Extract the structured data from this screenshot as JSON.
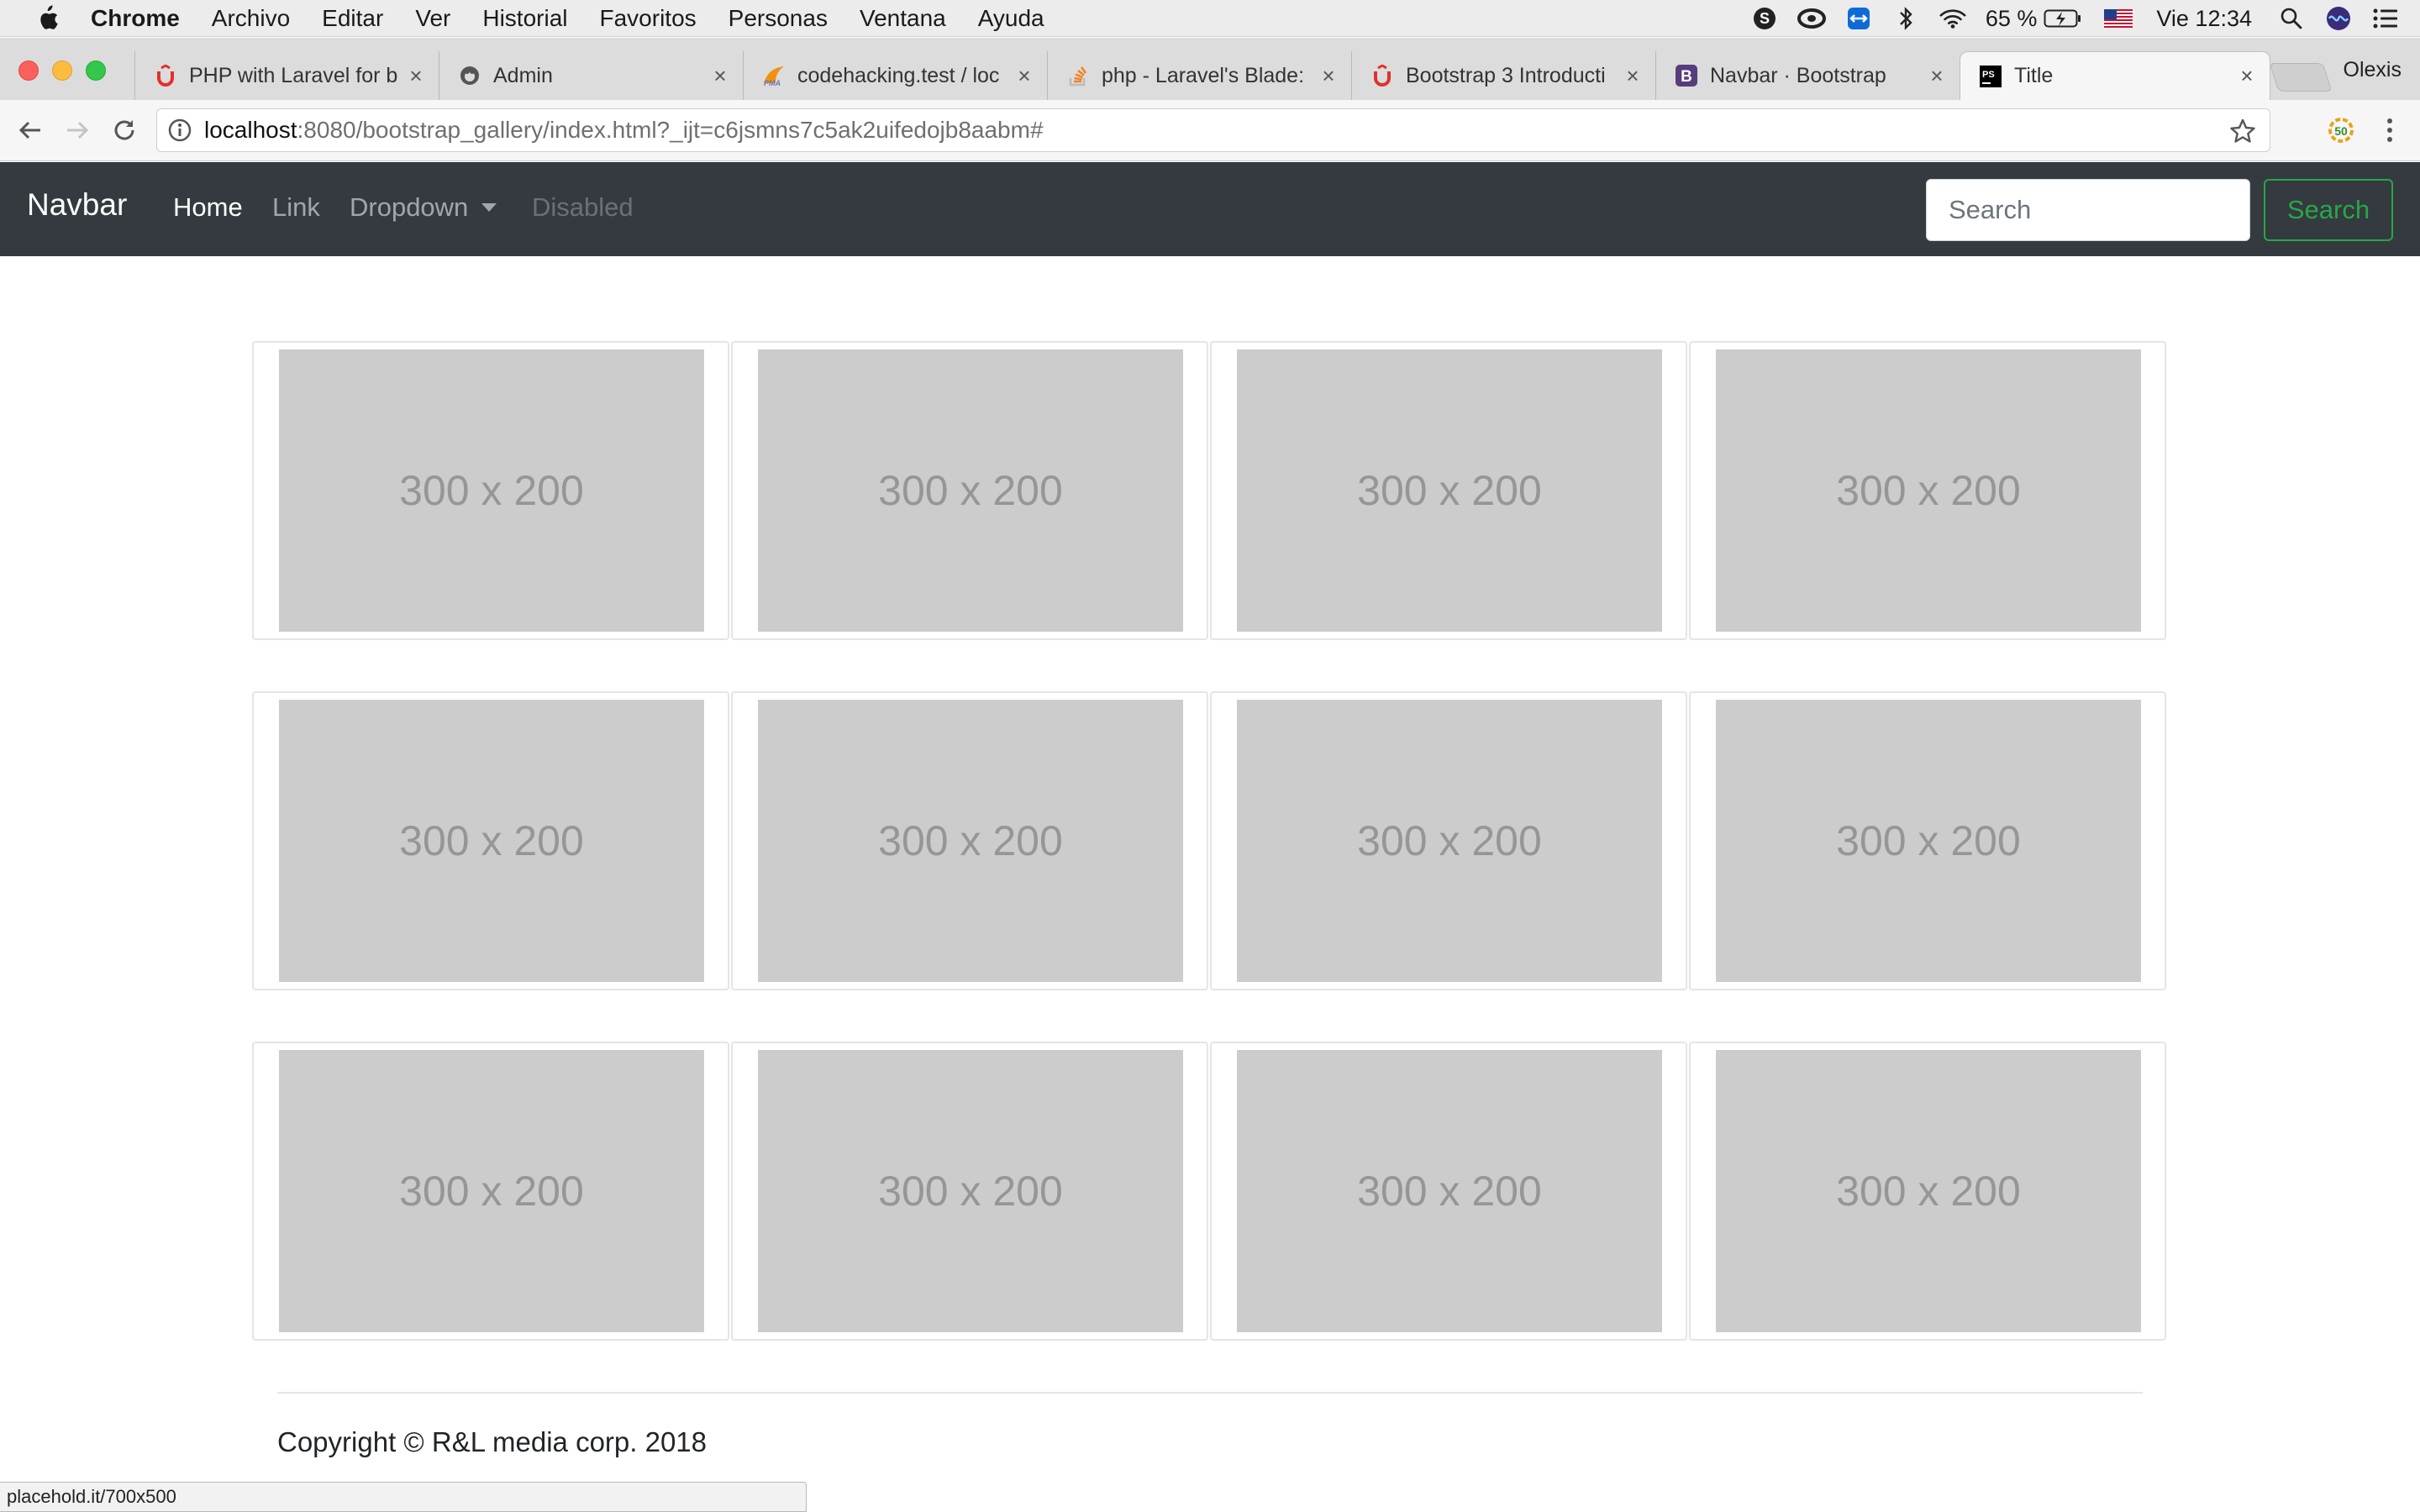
{
  "menubar": {
    "app": "Chrome",
    "items": [
      "Archivo",
      "Editar",
      "Ver",
      "Historial",
      "Favoritos",
      "Personas",
      "Ventana",
      "Ayuda"
    ],
    "battery": "65 %",
    "clock": "Vie 12:34"
  },
  "tabs": [
    {
      "title": "PHP with Laravel for b",
      "icon": "udemy-icon"
    },
    {
      "title": "Admin",
      "icon": "github-icon"
    },
    {
      "title": "codehacking.test / loc",
      "icon": "phpmyadmin-icon"
    },
    {
      "title": "php - Laravel's Blade:",
      "icon": "stackoverflow-icon"
    },
    {
      "title": "Bootstrap 3 Introducti",
      "icon": "udemy-icon"
    },
    {
      "title": "Navbar · Bootstrap",
      "icon": "bootstrap-icon"
    },
    {
      "title": "Title",
      "icon": "phpstorm-icon"
    }
  ],
  "profile": "Olexis",
  "address": {
    "host": "localhost",
    "rest": ":8080/bootstrap_gallery/index.html?_ijt=c6jsmns7c5ak2uifedojb8aabm#"
  },
  "navbar": {
    "brand": "Navbar",
    "home": "Home",
    "link": "Link",
    "dropdown": "Dropdown",
    "disabled": "Disabled",
    "search_placeholder": "Search",
    "search_button": "Search"
  },
  "gallery": {
    "items": [
      "300 x 200",
      "300 x 200",
      "300 x 200",
      "300 x 200",
      "300 x 200",
      "300 x 200",
      "300 x 200",
      "300 x 200",
      "300 x 200",
      "300 x 200",
      "300 x 200",
      "300 x 200"
    ]
  },
  "footer": {
    "copyright": "Copyright © R&L media corp. 2018"
  },
  "status_bar": {
    "url": "placehold.it/700x500"
  },
  "colors": {
    "navbar_bg": "#343a40",
    "success": "#28a745",
    "placeholder_bg": "#cccccc"
  }
}
